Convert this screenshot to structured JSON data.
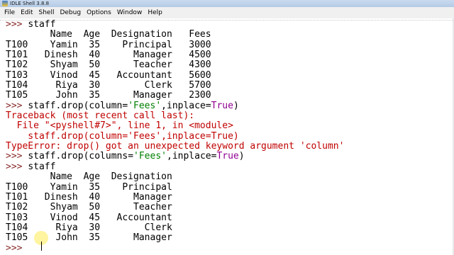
{
  "window": {
    "title": "IDLE Shell 3.8.8"
  },
  "menu": [
    "File",
    "Edit",
    "Shell",
    "Debug",
    "Options",
    "Window",
    "Help"
  ],
  "shell_lines": [
    {
      "segments": [
        {
          "t": ">>> ",
          "c": "prompt"
        },
        {
          "t": "staff",
          "c": "code"
        }
      ]
    },
    {
      "segments": [
        {
          "t": "        Name  Age  Designation   Fees",
          "c": "out"
        }
      ]
    },
    {
      "segments": [
        {
          "t": "T100    Yamin  35    Principal   3000",
          "c": "out"
        }
      ]
    },
    {
      "segments": [
        {
          "t": "T101   Dinesh  40      Manager   4500",
          "c": "out"
        }
      ]
    },
    {
      "segments": [
        {
          "t": "T102    Shyam  50      Teacher   4300",
          "c": "out"
        }
      ]
    },
    {
      "segments": [
        {
          "t": "T103    Vinod  45   Accountant   5600",
          "c": "out"
        }
      ]
    },
    {
      "segments": [
        {
          "t": "T104     Riya  30        Clerk   5700",
          "c": "out"
        }
      ]
    },
    {
      "segments": [
        {
          "t": "T105     John  35      Manager   2300",
          "c": "out"
        }
      ]
    },
    {
      "segments": [
        {
          "t": ">>> ",
          "c": "prompt"
        },
        {
          "t": "staff.drop(column=",
          "c": "code"
        },
        {
          "t": "'Fees'",
          "c": "str"
        },
        {
          "t": ",inplace=",
          "c": "code"
        },
        {
          "t": "True",
          "c": "kw"
        },
        {
          "t": ")",
          "c": "code"
        }
      ]
    },
    {
      "segments": [
        {
          "t": "Traceback (most recent call last):",
          "c": "err"
        }
      ]
    },
    {
      "segments": [
        {
          "t": "  File \"<pyshell#7>\", line 1, in <module>",
          "c": "err"
        }
      ]
    },
    {
      "segments": [
        {
          "t": "    staff.drop(column='Fees',inplace=True)",
          "c": "err"
        }
      ]
    },
    {
      "segments": [
        {
          "t": "TypeError: drop() got an unexpected keyword argument 'column'",
          "c": "err"
        }
      ]
    },
    {
      "segments": [
        {
          "t": ">>> ",
          "c": "prompt"
        },
        {
          "t": "staff.drop(columns=",
          "c": "code"
        },
        {
          "t": "'Fees'",
          "c": "str"
        },
        {
          "t": ",inplace=",
          "c": "code"
        },
        {
          "t": "True",
          "c": "kw"
        },
        {
          "t": ")",
          "c": "code"
        }
      ]
    },
    {
      "segments": [
        {
          "t": ">>> ",
          "c": "prompt"
        },
        {
          "t": "staff",
          "c": "code"
        }
      ]
    },
    {
      "segments": [
        {
          "t": "        Name  Age  Designation",
          "c": "out"
        }
      ]
    },
    {
      "segments": [
        {
          "t": "T100    Yamin  35    Principal",
          "c": "out"
        }
      ]
    },
    {
      "segments": [
        {
          "t": "T101   Dinesh  40      Manager",
          "c": "out"
        }
      ]
    },
    {
      "segments": [
        {
          "t": "T102    Shyam  50      Teacher",
          "c": "out"
        }
      ]
    },
    {
      "segments": [
        {
          "t": "T103    Vinod  45   Accountant",
          "c": "out"
        }
      ]
    },
    {
      "segments": [
        {
          "t": "T104     Riya  30        Clerk",
          "c": "out"
        }
      ]
    },
    {
      "segments": [
        {
          "t": "T105     John  35      Manager",
          "c": "out"
        }
      ]
    },
    {
      "segments": [
        {
          "t": ">>> ",
          "c": "prompt"
        }
      ]
    }
  ]
}
